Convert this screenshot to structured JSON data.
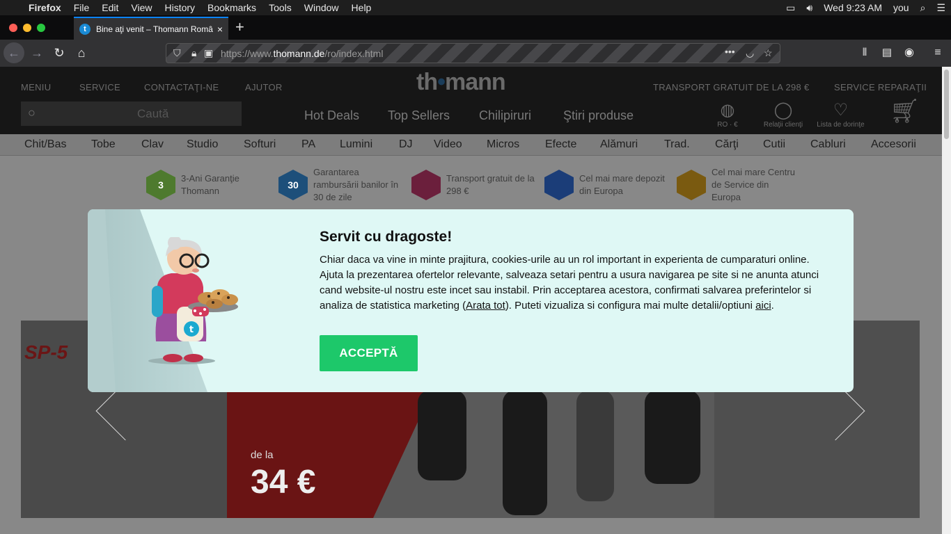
{
  "menubar": {
    "app": "Firefox",
    "items": [
      "File",
      "Edit",
      "View",
      "History",
      "Bookmarks",
      "Tools",
      "Window",
      "Help"
    ],
    "clock": "Wed 9:23 AM",
    "user": "you"
  },
  "tab": {
    "favicon": "t",
    "title": "Bine aţi venit – Thomann Român",
    "close": "×"
  },
  "url": {
    "prefix": "https://www.",
    "domain": "thomann.de",
    "path": "/ro/index.html"
  },
  "site": {
    "top_links": [
      "MENIU",
      "SERVICE",
      "CONTACTAŢI-NE",
      "AJUTOR"
    ],
    "logo_a": "th",
    "logo_dot": "•",
    "logo_b": "mann",
    "right_links": [
      "TRANSPORT GRATUIT DE LA 298 €",
      "SERVICE REPARAŢII"
    ],
    "search_placeholder": "Caută",
    "highlights": [
      "Hot Deals",
      "Top Sellers",
      "Chilipiruri",
      "Ştiri produse"
    ],
    "account": [
      "RO · €",
      "Relaţii clienţi",
      "Lista de dorinţe"
    ],
    "categories": [
      "Chit/Bas",
      "Tobe",
      "Clav",
      "Studio",
      "Softuri",
      "PA",
      "Lumini",
      "DJ",
      "Video",
      "Micros",
      "Efecte",
      "Alămuri",
      "Trad.",
      "Cărţi",
      "Cutii",
      "Cabluri",
      "Accesorii"
    ],
    "benefits": [
      {
        "text": "3-Ani Garanţie Thomann",
        "badge": "3"
      },
      {
        "text": "Garantarea rambursării banilor în 30 de zile",
        "badge": "30"
      },
      {
        "text": "Transport gratuit de la 298 €",
        "badge": ""
      },
      {
        "text": "Cel mai mare depozit din Europa",
        "badge": ""
      },
      {
        "text": "Cel mai mare Centru de Service din Europa",
        "badge": ""
      }
    ],
    "banner": {
      "keyboard": "SP-5",
      "dela": "de la",
      "price": "34 €"
    }
  },
  "modal": {
    "title": "Servit cu dragoste!",
    "body_1": "Chiar daca va vine in minte prajitura, cookies-urile au un rol important in experienta de cumparaturi online. Ajuta la prezentarea ofertelor relevante, salveaza setari pentru a usura navigarea pe site si ne anunta atunci cand website-ul nostru este incet sau instabil. Prin acceptarea acestora, confirmati salvarea preferintelor si analiza de statistica marketing (",
    "link_all": "Arata tot",
    "body_2": "). Puteti vizualiza si configura mai multe detalii/optiuni ",
    "link_here": "aici",
    "body_3": ".",
    "accept": "ACCEPTĂ",
    "apron_letter": "t"
  },
  "colors": {
    "accept_bg": "#1dc86a",
    "modal_bg": "#dff8f5",
    "tab_accent": "#0a84ff"
  }
}
